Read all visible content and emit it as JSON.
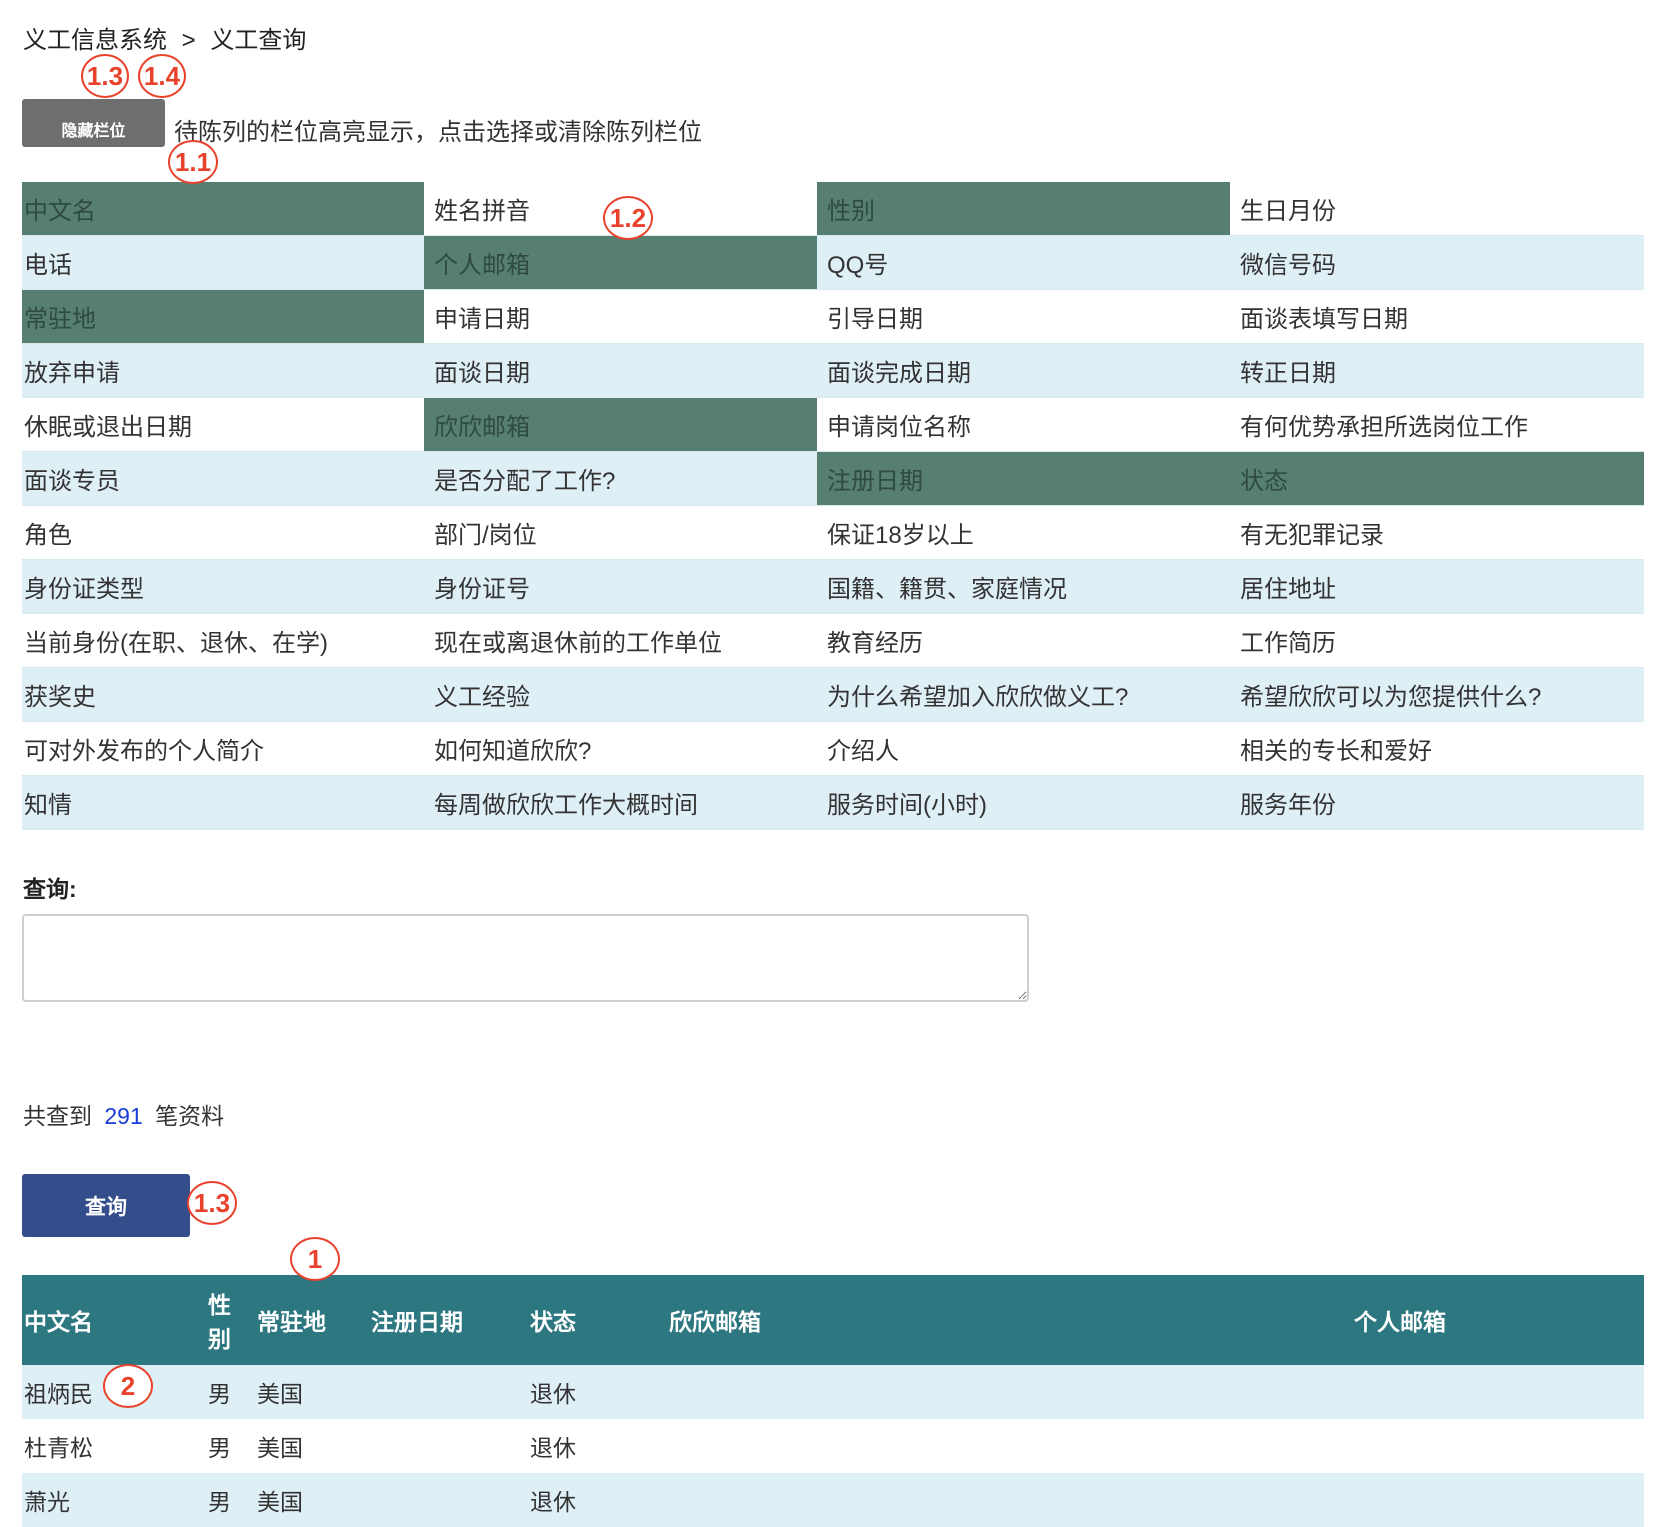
{
  "breadcrumb": {
    "root": "义工信息系统",
    "separator": ">",
    "current": "义工查询"
  },
  "hide_button_label": "隐藏栏位",
  "hint_text": "待陈列的栏位高亮显示，点击选择或清除陈列栏位",
  "fields": [
    {
      "label": "中文名",
      "selected": true
    },
    {
      "label": "姓名拼音",
      "selected": false
    },
    {
      "label": "性别",
      "selected": true
    },
    {
      "label": "生日月份",
      "selected": false
    },
    {
      "label": "电话",
      "selected": false
    },
    {
      "label": "个人邮箱",
      "selected": true
    },
    {
      "label": "QQ号",
      "selected": false
    },
    {
      "label": "微信号码",
      "selected": false
    },
    {
      "label": "常驻地",
      "selected": true
    },
    {
      "label": "申请日期",
      "selected": false
    },
    {
      "label": "引导日期",
      "selected": false
    },
    {
      "label": "面谈表填写日期",
      "selected": false
    },
    {
      "label": "放弃申请",
      "selected": false
    },
    {
      "label": "面谈日期",
      "selected": false
    },
    {
      "label": "面谈完成日期",
      "selected": false
    },
    {
      "label": "转正日期",
      "selected": false
    },
    {
      "label": "休眠或退出日期",
      "selected": false
    },
    {
      "label": "欣欣邮箱",
      "selected": true
    },
    {
      "label": "申请岗位名称",
      "selected": false
    },
    {
      "label": "有何优势承担所选岗位工作",
      "selected": false
    },
    {
      "label": "面谈专员",
      "selected": false
    },
    {
      "label": "是否分配了工作?",
      "selected": false
    },
    {
      "label": "注册日期",
      "selected": true
    },
    {
      "label": "状态",
      "selected": true
    },
    {
      "label": "角色",
      "selected": false
    },
    {
      "label": "部门/岗位",
      "selected": false
    },
    {
      "label": "保证18岁以上",
      "selected": false
    },
    {
      "label": "有无犯罪记录",
      "selected": false
    },
    {
      "label": "身份证类型",
      "selected": false
    },
    {
      "label": "身份证号",
      "selected": false
    },
    {
      "label": "国籍、籍贯、家庭情况",
      "selected": false
    },
    {
      "label": "居住地址",
      "selected": false
    },
    {
      "label": "当前身份(在职、退休、在学)",
      "selected": false
    },
    {
      "label": "现在或离退休前的工作单位",
      "selected": false
    },
    {
      "label": "教育经历",
      "selected": false
    },
    {
      "label": "工作简历",
      "selected": false
    },
    {
      "label": "获奖史",
      "selected": false
    },
    {
      "label": "义工经验",
      "selected": false
    },
    {
      "label": "为什么希望加入欣欣做义工?",
      "selected": false
    },
    {
      "label": "希望欣欣可以为您提供什么?",
      "selected": false
    },
    {
      "label": "可对外发布的个人简介",
      "selected": false
    },
    {
      "label": "如何知道欣欣?",
      "selected": false
    },
    {
      "label": "介绍人",
      "selected": false
    },
    {
      "label": "相关的专长和爱好",
      "selected": false
    },
    {
      "label": "知情",
      "selected": false
    },
    {
      "label": "每周做欣欣工作大概时间",
      "selected": false
    },
    {
      "label": "服务时间(小时)",
      "selected": false
    },
    {
      "label": "服务年份",
      "selected": false
    }
  ],
  "query": {
    "label": "查询:",
    "value": "",
    "placeholder": ""
  },
  "result_count": {
    "prefix": "共查到",
    "count": "291",
    "suffix": "笔资料"
  },
  "query_button_label": "查询",
  "results_table": {
    "headers": [
      "中文名",
      "性别",
      "常驻地",
      "注册日期",
      "状态",
      "欣欣邮箱",
      "个人邮箱"
    ],
    "rows": [
      [
        "祖炳民",
        "男",
        "美国",
        "",
        "退休",
        "",
        ""
      ],
      [
        "杜青松",
        "男",
        "美国",
        "",
        "退休",
        "",
        ""
      ],
      [
        "萧光",
        "男",
        "美国",
        "",
        "退休",
        "",
        ""
      ]
    ]
  },
  "annotations": [
    "1.3",
    "1.4",
    "1.1",
    "1.2",
    "1.3",
    "1",
    "2"
  ],
  "colors": {
    "selected_field_bg": "#567f72",
    "row_tint": "#dfeff6",
    "hide_button_bg": "#6e6e6e",
    "query_button_bg": "#344e8c",
    "table_header_bg": "#2c7780",
    "count_color": "#1a3cd6",
    "annotation_color": "#e8412c"
  }
}
